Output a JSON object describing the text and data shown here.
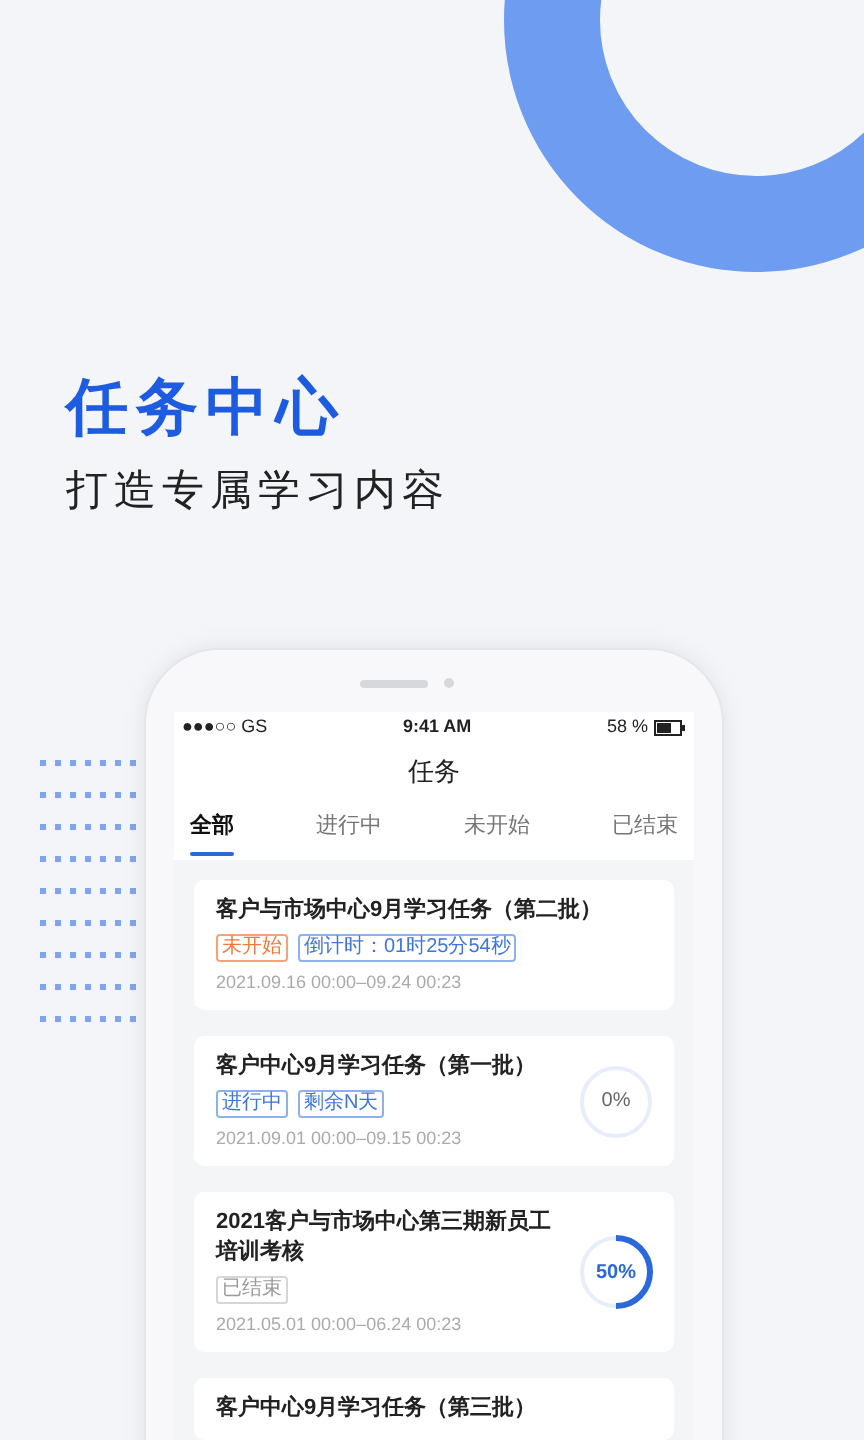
{
  "promo": {
    "title": "任务中心",
    "subtitle": "打造专属学习内容"
  },
  "status_bar": {
    "carrier": "●●●○○ GS",
    "time": "9:41 AM",
    "battery": "58 %"
  },
  "nav": {
    "title": "任务"
  },
  "tabs": [
    {
      "label": "全部",
      "selected": true
    },
    {
      "label": "进行中",
      "selected": false
    },
    {
      "label": "未开始",
      "selected": false
    },
    {
      "label": "已结束",
      "selected": false
    }
  ],
  "tasks": [
    {
      "title": "客户与市场中心9月学习任务（第二批）",
      "tags": [
        {
          "text": "未开始",
          "kind": "orange"
        },
        {
          "text": "倒计时：01时25分54秒",
          "kind": "blue"
        }
      ],
      "period": "2021.09.16 00:00–09.24 00:23"
    },
    {
      "title": "客户中心9月学习任务（第一批）",
      "tags": [
        {
          "text": "进行中",
          "kind": "blue"
        },
        {
          "text": "剩余N天",
          "kind": "blue"
        }
      ],
      "period": "2021.09.01 00:00–09.15 00:23",
      "progress": {
        "text": "0%",
        "level": 0
      }
    },
    {
      "title": "2021客户与市场中心第三期新员工培训考核",
      "tags": [
        {
          "text": "已结束",
          "kind": "gray"
        }
      ],
      "period": "2021.05.01 00:00–06.24 00:23",
      "progress": {
        "text": "50%",
        "level": 0.5
      }
    },
    {
      "title": "客户中心9月学习任务（第三批）"
    }
  ]
}
